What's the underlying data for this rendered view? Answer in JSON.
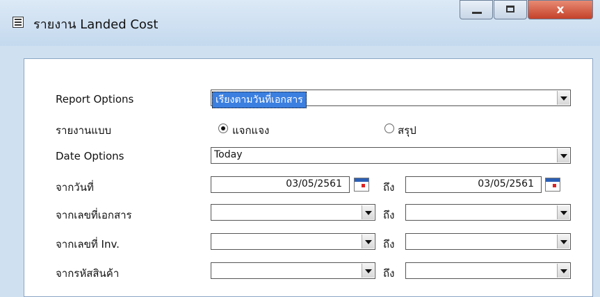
{
  "window": {
    "title": "รายงาน Landed Cost",
    "close_label": "x"
  },
  "form": {
    "report_options": {
      "label": "Report Options",
      "value": "เรียงตามวันที่เอกสาร"
    },
    "report_type": {
      "label": "รายงานแบบ",
      "options": [
        {
          "label": "แจกแจง",
          "selected": true
        },
        {
          "label": "สรุป",
          "selected": false
        }
      ]
    },
    "date_options": {
      "label": "Date Options",
      "value": "Today"
    },
    "to_label": "ถึง",
    "from_date": {
      "label": "จากวันที่",
      "from": "03/05/2561",
      "to": "03/05/2561"
    },
    "from_doc_no": {
      "label": "จากเลขที่เอกสาร"
    },
    "from_inv_no": {
      "label": "จากเลขที่ Inv."
    },
    "from_product_code": {
      "label": "จากรหัสสินค้า"
    }
  }
}
